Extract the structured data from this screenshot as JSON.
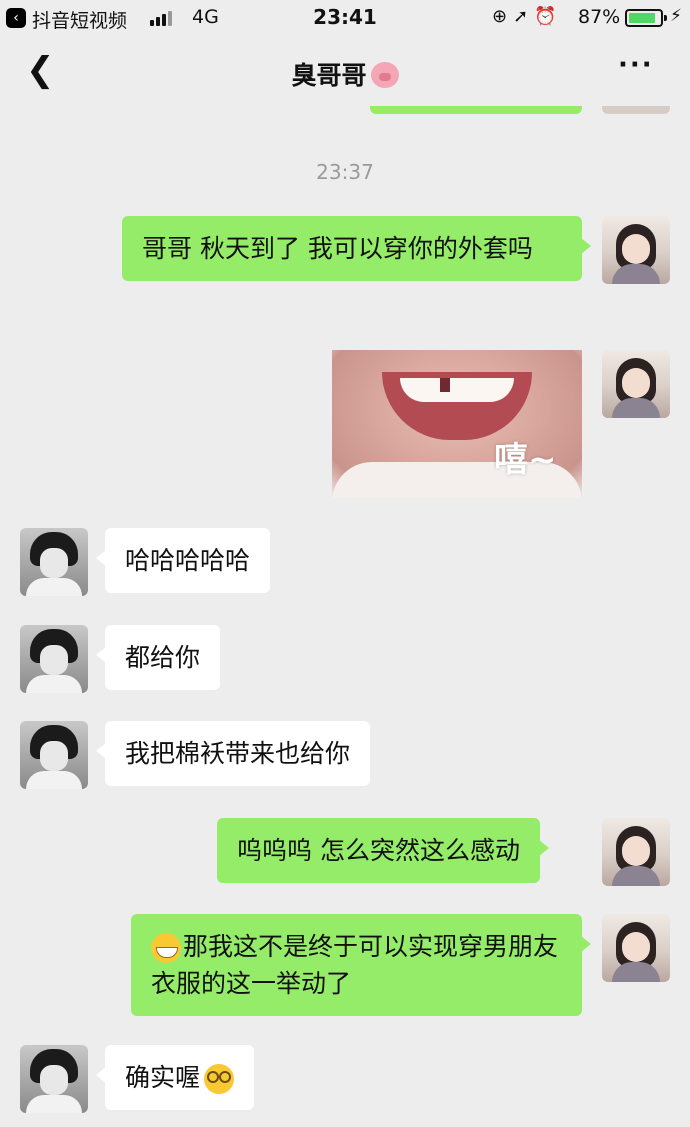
{
  "status_bar": {
    "back_app_label": "抖音短视频",
    "network": "4G",
    "time": "23:41",
    "battery_percent": "87%",
    "battery_level": 0.87
  },
  "nav": {
    "title": "臭哥哥",
    "title_emoji": "pig-face-icon"
  },
  "timestamp": "23:37",
  "messages": [
    {
      "side": "me",
      "type": "text",
      "text": "哥哥 秋天到了 我可以穿你的外套吗"
    },
    {
      "side": "me",
      "type": "image",
      "caption": "嘻~"
    },
    {
      "side": "them",
      "type": "text",
      "text": "哈哈哈哈哈"
    },
    {
      "side": "them",
      "type": "text",
      "text": "都给你"
    },
    {
      "side": "them",
      "type": "text",
      "text": "我把棉袄带来也给你"
    },
    {
      "side": "me",
      "type": "text",
      "text": "呜呜呜 怎么突然这么感动"
    },
    {
      "side": "me",
      "type": "text",
      "emoji": "grinning-face-icon",
      "text": "那我这不是终于可以实现穿男朋友衣服的这一举动了"
    },
    {
      "side": "them",
      "type": "text",
      "emoji": "nerd-face-icon",
      "text": "确实喔"
    }
  ],
  "colors": {
    "background": "#ededed",
    "my_bubble": "#95ec69",
    "their_bubble": "#ffffff",
    "timestamp": "#9a9a9a"
  }
}
